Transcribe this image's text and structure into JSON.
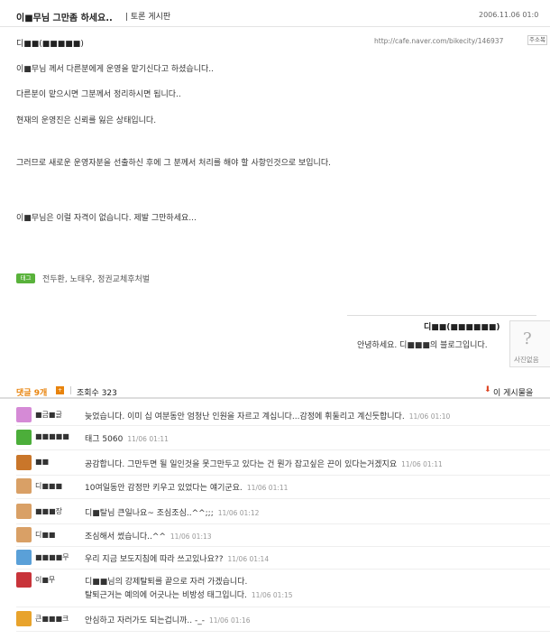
{
  "post": {
    "title": "이■무님 그만좀 하세요..",
    "board": "| 토론 게시판",
    "date": "2006.11.06 01:0",
    "author": "디■■(■■■■■)",
    "url": "http://cafe.naver.com/bikecity/146937",
    "addr_button": "주소복"
  },
  "body": {
    "lines": [
      "이■무님 께서 다른분에게 운영을 맡기신다고 하셨습니다..",
      "다른분이 맡으시면 그분께서 정리하시면 됩니다..",
      "현재의 운영진은 신뢰를 잃은 상태입니다.",
      "그러므로 새로운 운영자분을 선출하신 후에 그 분께서 처리를 해야 할 사항인것으로 보입니다.",
      "이■무님은 이럴 자격이 없습니다. 제발 그만하세요..."
    ]
  },
  "tags": {
    "icon_label": "태그",
    "list": "전두환, 노태우, 정권교체후처벌"
  },
  "signature": {
    "name": "디■■(■■■■■■)",
    "greeting": "안녕하세요. 디■■■의 블로그입니다."
  },
  "photo": {
    "label": "사진없음"
  },
  "comments_header": {
    "count_label": "댓글 9개",
    "badge": "+",
    "sep": "|",
    "views_label": "조회수 323",
    "this_post_label": "이 게시물을"
  },
  "comments": [
    {
      "nick": "■금■글",
      "avatar_color": "#d58ad6",
      "text": "늦었습니다. 이미 십 여분동안 엄청난 인원을 자르고 계십니다...감정에 휘둘리고 계신듯합니다.",
      "time": "11/06 01:10"
    },
    {
      "nick": "■■■■■",
      "avatar_color": "#4cae3a",
      "text": "태그 5060",
      "time": "11/06 01:11"
    },
    {
      "nick": "■■",
      "avatar_color": "#c9762a",
      "text": "공감합니다. 그만두면 될 일인것을 못그만두고 있다는 건 뭔가 잡고싶은 끈이 있다는거겠지요",
      "time": "11/06 01:11"
    },
    {
      "nick": "디■■■",
      "avatar_color": "#d9a066",
      "text": "10여일동안 감정만 키우고 있었다는 얘기군요.",
      "time": "11/06 01:11"
    },
    {
      "nick": "■■■장",
      "avatar_color": "#d9a066",
      "text": "디■탈님 큰일나요~ 조심조심..^^;;;",
      "time": "11/06 01:12"
    },
    {
      "nick": "디■■",
      "avatar_color": "#d9a066",
      "text": "조심해서 썼습니다..^^",
      "time": "11/06 01:13"
    },
    {
      "nick": "■■■■무",
      "avatar_color": "#5aa0d8",
      "text": "우리 지금 보도지침에 따라 쓰고있나요??",
      "time": "11/06 01:14"
    },
    {
      "nick": "이■무",
      "avatar_color": "#c8343a",
      "text": "디■■님의 강제탈퇴를 끝으로 자러 가겠습니다.",
      "text2": "탈퇴근거는 예의에 어긋나는 비방성 태그입니다.",
      "time": "11/06 01:15"
    },
    {
      "nick": "큰■■■크",
      "avatar_color": "#e8a32c",
      "text": "안심하고 자러가도 되는겁니까.. -_-",
      "time": "11/06 01:16"
    }
  ]
}
